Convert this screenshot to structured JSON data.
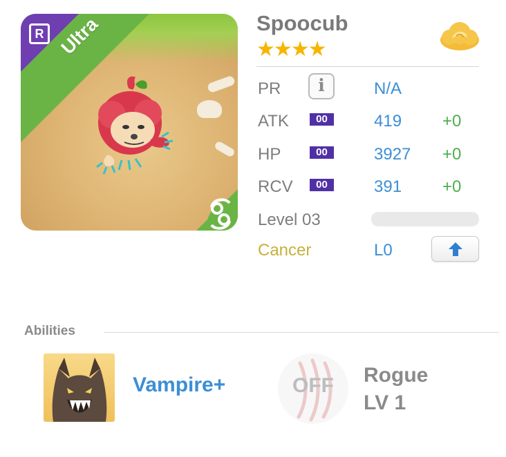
{
  "card": {
    "rarity_icon": "R",
    "rarity_label": "Ultra",
    "zodiac_icon": "cancer-zodiac-icon"
  },
  "monster": {
    "name": "Spoocub",
    "stars": "★★★★",
    "star_count": 4,
    "element_icon": "cloud-icon"
  },
  "stats": {
    "pr": {
      "label": "PR",
      "info_icon": "i",
      "value": "N/A"
    },
    "atk": {
      "label": "ATK",
      "badge": "00",
      "value": "419",
      "bonus": "+0"
    },
    "hp": {
      "label": "HP",
      "badge": "00",
      "value": "3927",
      "bonus": "+0"
    },
    "rcv": {
      "label": "RCV",
      "badge": "00",
      "value": "391",
      "bonus": "+0"
    },
    "level": {
      "label": "Level 03",
      "progress": 0
    },
    "zodiac": {
      "label": "Cancer",
      "value": "L0",
      "upgrade_icon": "arrow-up-icon"
    }
  },
  "abilities": {
    "title": "Abilities",
    "ability": {
      "name": "Vampire+",
      "icon": "werewolf-icon"
    },
    "class": {
      "status": "OFF",
      "name": "Rogue",
      "level": "LV 1",
      "icon": "claw-marks-icon"
    }
  },
  "colors": {
    "accent_blue": "#3b8ed6",
    "bonus_green": "#4caf50",
    "badge_purple": "#5130a6",
    "ultra_green": "#6ab446",
    "rarity_purple": "#6f3fb1",
    "star_gold": "#f7b500",
    "zodiac_gold": "#c7b13b"
  }
}
